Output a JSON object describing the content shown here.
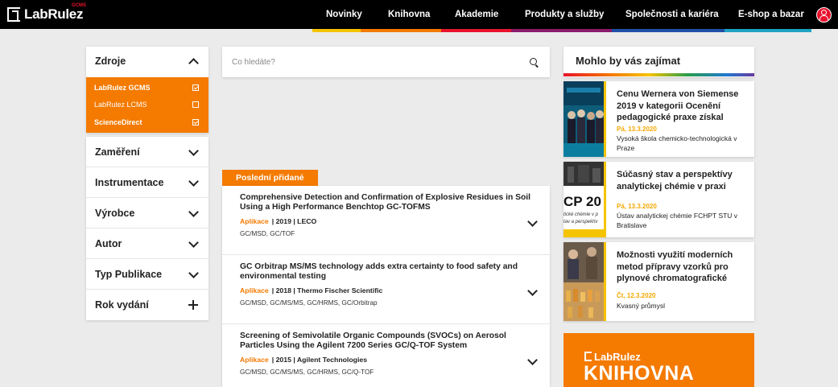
{
  "header": {
    "logo_text": "LabRulez",
    "logo_sub": "GCMS",
    "nav": [
      "Novinky",
      "Knihovna",
      "Akademie",
      "Produkty a služby",
      "Společnosti a kariéra",
      "E-shop a bazar"
    ],
    "stripe_colors": [
      "#f5c400",
      "#f47a00",
      "#e8132d",
      "#8a1a6a",
      "#6a3aa0",
      "#1f7ad1",
      "#1f4fa8",
      "#1fa3c4"
    ]
  },
  "filters": {
    "sources_title": "Zdroje",
    "sources": [
      {
        "label": "LabRulez GCMS",
        "checked": true
      },
      {
        "label": "LabRulez LCMS",
        "checked": false
      },
      {
        "label": "ScienceDirect",
        "checked": true
      }
    ],
    "groups": [
      "Zaměření",
      "Instrumentace",
      "Výrobce",
      "Autor",
      "Typ Publikace",
      "Rok vydání"
    ]
  },
  "search": {
    "placeholder": "Co hledáte?"
  },
  "recent": {
    "tab_label": "Poslední přidané",
    "articles": [
      {
        "title": "Comprehensive Detection and Confirmation of Explosive Residues in Soil Using a High Performance Benchtop GC-TOFMS",
        "type": "Aplikace",
        "meta": "| 2019 | LECO",
        "tags": "GC/MSD, GC/TOF"
      },
      {
        "title": "GC Orbitrap MS/MS technology adds extra certainty to food safety and environmental testing",
        "type": "Aplikace",
        "meta": "| 2018 | Thermo Fischer Scientific",
        "tags": "GC/MSD, GC/MS/MS, GC/HRMS, GC/Orbitrap"
      },
      {
        "title": "Screening of Semivolatile Organic Compounds (SVOCs) on Aerosol Particles Using the Agilent 7200 Series GC/Q-TOF System",
        "type": "Aplikace",
        "meta": "| 2015 | Agilent Technologies",
        "tags": "GC/MSD, GC/MS/MS, GC/HRMS, GC/Q-TOF"
      }
    ]
  },
  "sidebar": {
    "title": "Mohlo by vás zajímat",
    "news": [
      {
        "title": "Cenu Wernera von Siemense 2019 v kategorii Ocenění pedagogické praxe získal",
        "date": "Pá, 13.3.2020",
        "source": "Vysoká škola chemicko-technologická v Praze"
      },
      {
        "title": "Súčasný stav a perspektívy analytickej chémie v praxi",
        "date": "Pá, 13.3.2020",
        "source": "Ústav analytickej chémie FCHPT STU v Bratislave",
        "thumb_text": "CP 20",
        "thumb_sub1": "tické chémie v p",
        "thumb_sub2": "tav a perspektív"
      },
      {
        "title": "Možnosti využití moderních metod přípravy vzorků pro plynové chromatografické",
        "date": "Čt, 12.3.2020",
        "source": "Kvasný průmysl"
      }
    ],
    "promo_logo": "LabRulez",
    "promo_title": "KNIHOVNA"
  }
}
